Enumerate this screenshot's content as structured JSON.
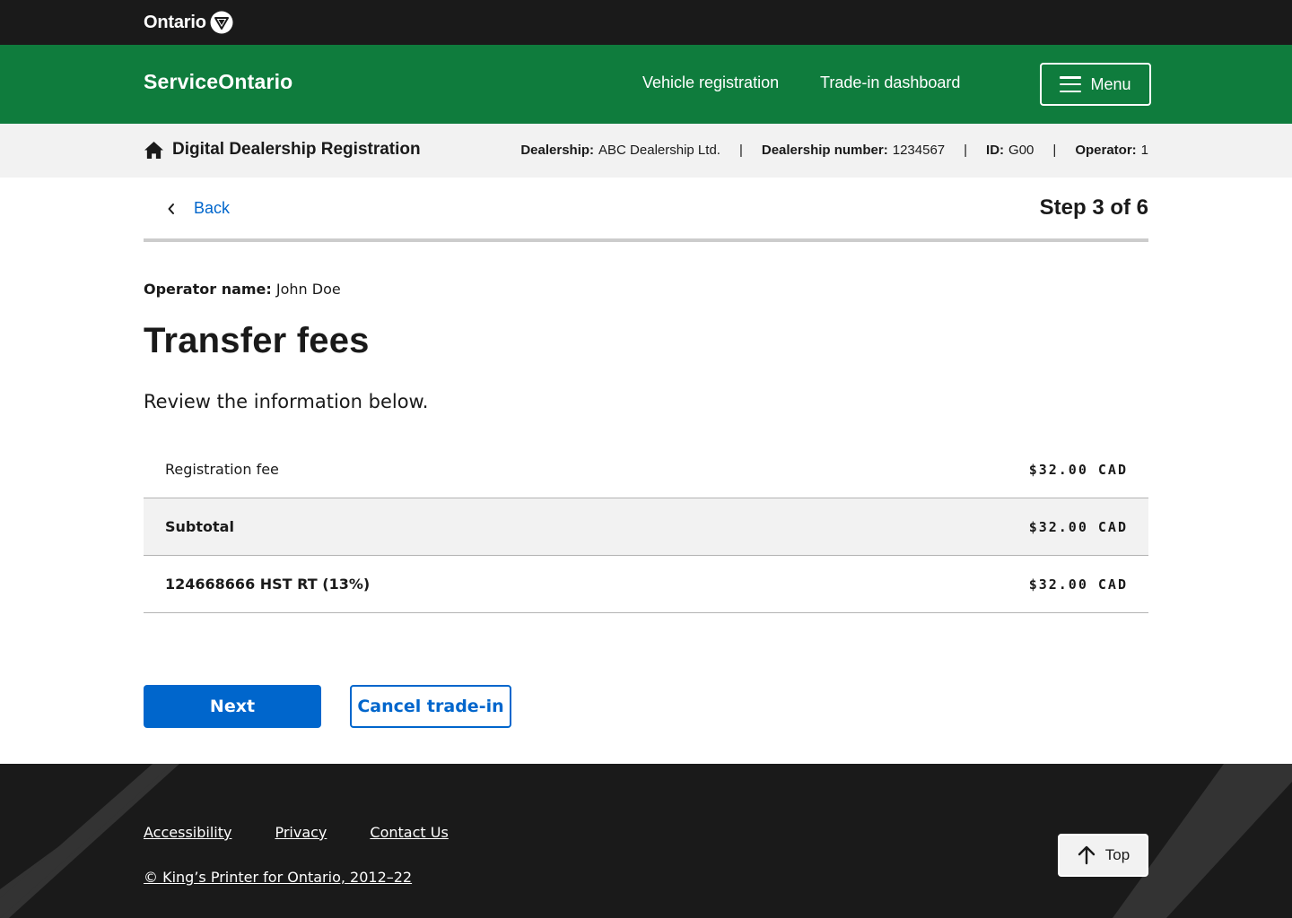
{
  "topbar": {
    "logo_text": "Ontario"
  },
  "header": {
    "brand": "ServiceOntario",
    "nav": [
      "Vehicle registration",
      "Trade-in dashboard"
    ],
    "menu_label": "Menu"
  },
  "subheader": {
    "title": "Digital Dealership Registration",
    "dealership_label": "Dealership:",
    "dealership_value": "ABC Dealership Ltd.",
    "dealership_number_label": "Dealership number:",
    "dealership_number_value": "1234567",
    "id_label": "ID:",
    "id_value": "G00",
    "operator_label": "Operator:",
    "operator_value": "1",
    "separator": "|"
  },
  "progress": {
    "back_label": "Back",
    "step_text": "Step 3 of 6"
  },
  "main": {
    "operator_label": "Operator name:",
    "operator_value": "John Doe",
    "title": "Transfer fees",
    "intro": "Review the information below.",
    "fees": [
      {
        "label": "Registration fee",
        "amount": "$32.00 CAD"
      },
      {
        "label": "Subtotal",
        "amount": "$32.00 CAD"
      },
      {
        "label": "124668666 HST RT (13%)",
        "amount": "$32.00 CAD"
      }
    ],
    "next_label": "Next",
    "cancel_label": "Cancel trade-in"
  },
  "footer": {
    "links": [
      "Accessibility",
      "Privacy",
      "Contact Us"
    ],
    "copyright": "© King’s Printer for Ontario, 2012–22",
    "top_label": "Top"
  },
  "colors": {
    "green": "#0f7c3d",
    "dark": "#1a1a1a",
    "blue": "#0066cc",
    "light_grey": "#f2f2f2"
  }
}
